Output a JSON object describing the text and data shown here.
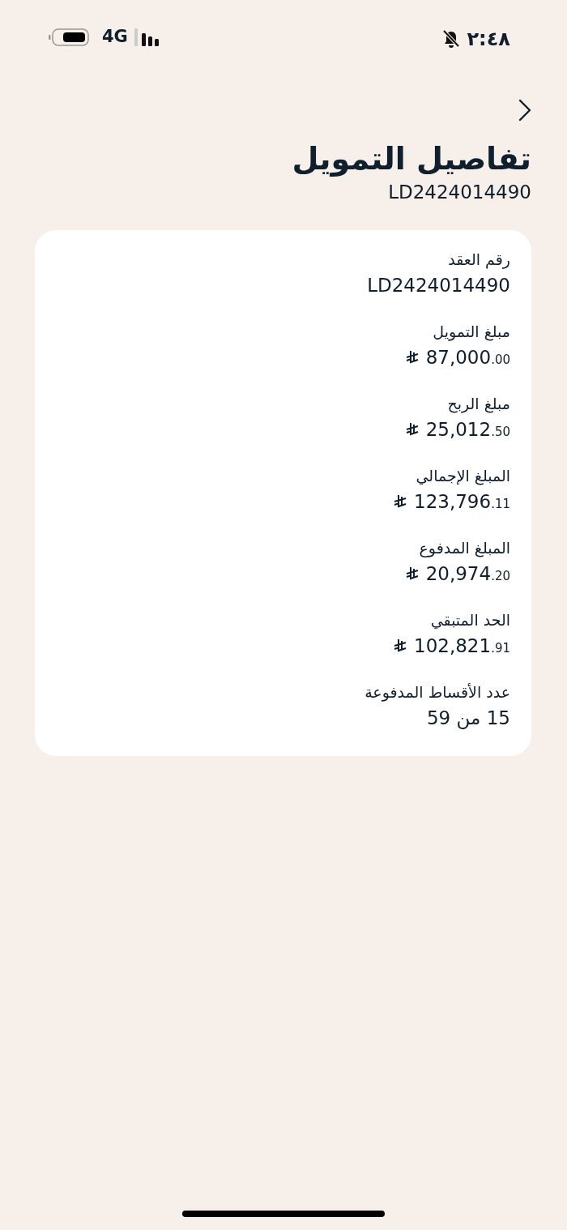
{
  "status_bar": {
    "time": "٢:٤٨",
    "network": "4G",
    "silent": true
  },
  "header": {
    "title": "تفاصيل التمويل",
    "subtitle": "LD2424014490"
  },
  "details": [
    {
      "kind": "text",
      "label": "رقم العقد",
      "value": "LD2424014490"
    },
    {
      "kind": "money",
      "label": "مبلغ التمويل",
      "value": "87,000$_{.00}$"
    },
    {
      "kind": "money",
      "label": "مبلغ الربح",
      "value": "25,012$_{.50}$"
    },
    {
      "kind": "money",
      "label": "المبلغ الإجمالي",
      "value": "123,796$_{.11}$"
    },
    {
      "kind": "money",
      "label": "المبلغ المدفوع",
      "value": "20,974$_{.20}$"
    },
    {
      "kind": "money",
      "label": "الحد المتبقي",
      "value": "102,821$_{.91}$"
    },
    {
      "kind": "text",
      "label": "عدد الأقساط المدفوعة",
      "value": "15 من 59"
    }
  ]
}
